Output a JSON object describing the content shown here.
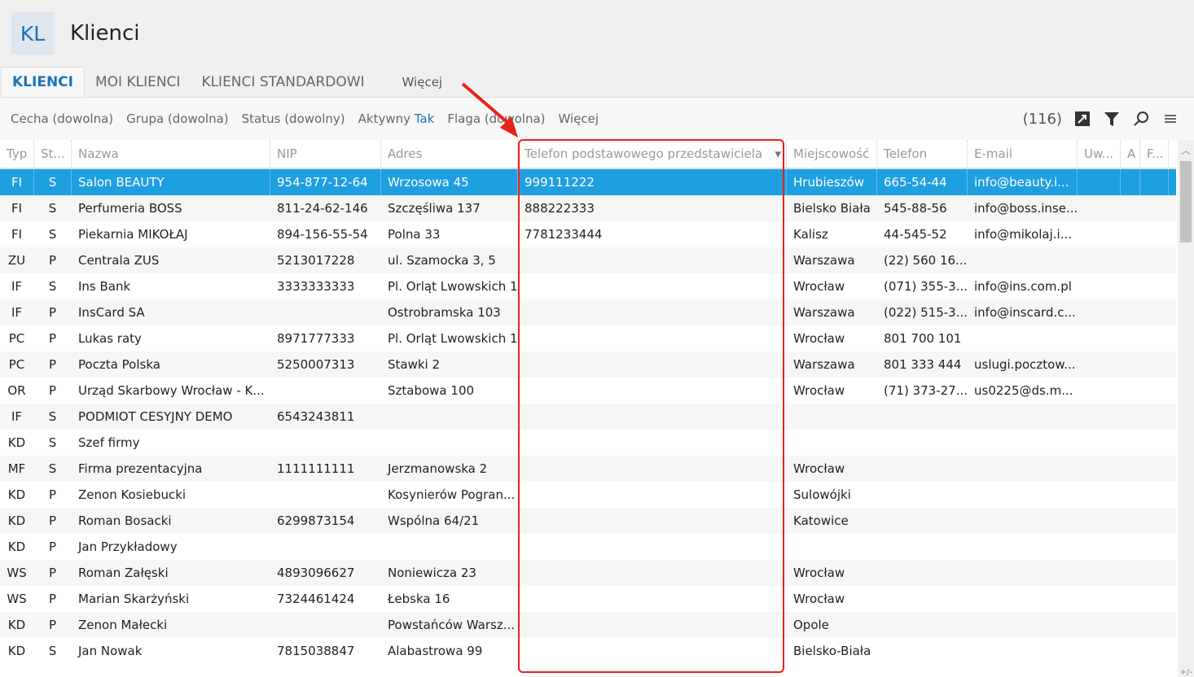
{
  "header": {
    "logo": "KL",
    "title": "Klienci"
  },
  "tabs": [
    {
      "label": "KLIENCI",
      "active": true
    },
    {
      "label": "MOI KLIENCI"
    },
    {
      "label": "KLIENCI STANDARDOWI"
    }
  ],
  "tabs_more": "Więcej",
  "filters": {
    "cecha": "Cecha (dowolna)",
    "grupa": "Grupa (dowolna)",
    "status": "Status (dowolny)",
    "aktywny_label": "Aktywny",
    "aktywny_value": "Tak",
    "flaga": "Flaga (dowolna)",
    "more": "Więcej"
  },
  "toolbar": {
    "count": "(116)",
    "icons": [
      "export-icon",
      "filter-icon",
      "search-icon",
      "menu-icon"
    ]
  },
  "columns": [
    "Typ",
    "St...",
    "Nazwa",
    "NIP",
    "Adres",
    "Telefon podstawowego przedstawiciela",
    "Miejscowość",
    "Telefon",
    "E-mail",
    "Uw...",
    "A",
    "F..."
  ],
  "rows": [
    [
      "FI",
      "S",
      "Salon BEAUTY",
      "954-877-12-64",
      "Wrzosowa  45",
      "999111222",
      "Hrubieszów",
      "665-54-44",
      "info@beauty.i..."
    ],
    [
      "FI",
      "S",
      "Perfumeria BOSS",
      "811-24-62-146",
      "Szczęśliwa  137",
      "888222333",
      "Bielsko Biała",
      "545-88-56",
      "info@boss.inse..."
    ],
    [
      "FI",
      "S",
      "Piekarnia MIKOŁAJ",
      "894-156-55-54",
      "Polna  33",
      "7781233444",
      "Kalisz",
      "44-545-52",
      "info@mikolaj.i..."
    ],
    [
      "ZU",
      "P",
      "Centrala ZUS",
      "5213017228",
      "ul. Szamocka 3, 5",
      "",
      "Warszawa",
      "(22) 560 16...",
      ""
    ],
    [
      "IF",
      "S",
      "Ins Bank",
      "3333333333",
      "Pl. Orląt Lwowskich 1",
      "",
      "Wrocław",
      "(071) 355-3...",
      "info@ins.com.pl"
    ],
    [
      "IF",
      "P",
      "InsCard SA",
      "",
      "Ostrobramska 103",
      "",
      "Warszawa",
      "(022) 515-3...",
      "info@inscard.c..."
    ],
    [
      "PC",
      "P",
      "Lukas raty",
      "8971777333",
      "Pl. Orląt Lwowskich 1",
      "",
      "Wrocław",
      "801 700 101",
      ""
    ],
    [
      "PC",
      "P",
      "Poczta Polska",
      "5250007313",
      "Stawki 2",
      "",
      "Warszawa",
      "801 333 444",
      "uslugi.pocztow..."
    ],
    [
      "OR",
      "P",
      "Urząd Skarbowy Wrocław - K...",
      "",
      "Sztabowa 100",
      "",
      "Wrocław",
      "(71) 373-27...",
      "us0225@ds.m..."
    ],
    [
      "IF",
      "S",
      "PODMIOT CESYJNY DEMO",
      "6543243811",
      "",
      "",
      "",
      "",
      ""
    ],
    [
      "KD",
      "S",
      "Szef firmy",
      "",
      "",
      "",
      "",
      "",
      ""
    ],
    [
      "MF",
      "S",
      "Firma prezentacyjna",
      "1111111111",
      "Jerzmanowska 2",
      "",
      "Wrocław",
      "",
      ""
    ],
    [
      "KD",
      "P",
      "Zenon Kosiebucki",
      "",
      "Kosynierów Pogran...",
      "",
      "Sulowójki",
      "",
      ""
    ],
    [
      "KD",
      "P",
      "Roman Bosacki",
      "6299873154",
      "Wspólna 64/21",
      "",
      "Katowice",
      "",
      ""
    ],
    [
      "KD",
      "P",
      "Jan Przykładowy",
      "",
      "",
      "",
      "",
      "",
      ""
    ],
    [
      "WS",
      "P",
      "Roman Załęski",
      "4893096627",
      "Noniewicza 23",
      "",
      "Wrocław",
      "",
      ""
    ],
    [
      "WS",
      "P",
      "Marian Skarżyński",
      "7324461424",
      "Łebska 16",
      "",
      "Wrocław",
      "",
      ""
    ],
    [
      "KD",
      "P",
      "Zenon Małecki",
      "",
      "Powstańców Warsz...",
      "",
      "Opole",
      "",
      ""
    ],
    [
      "KD",
      "S",
      "Jan Nowak",
      "7815038847",
      "Alabastrowa 99",
      "",
      "Bielsko-Biała",
      "",
      ""
    ]
  ],
  "selected_row": 0,
  "corner": "+/-",
  "colors": {
    "accent": "#1a73b8",
    "selection": "#1e9fe0",
    "annotation": "#e8221c"
  }
}
